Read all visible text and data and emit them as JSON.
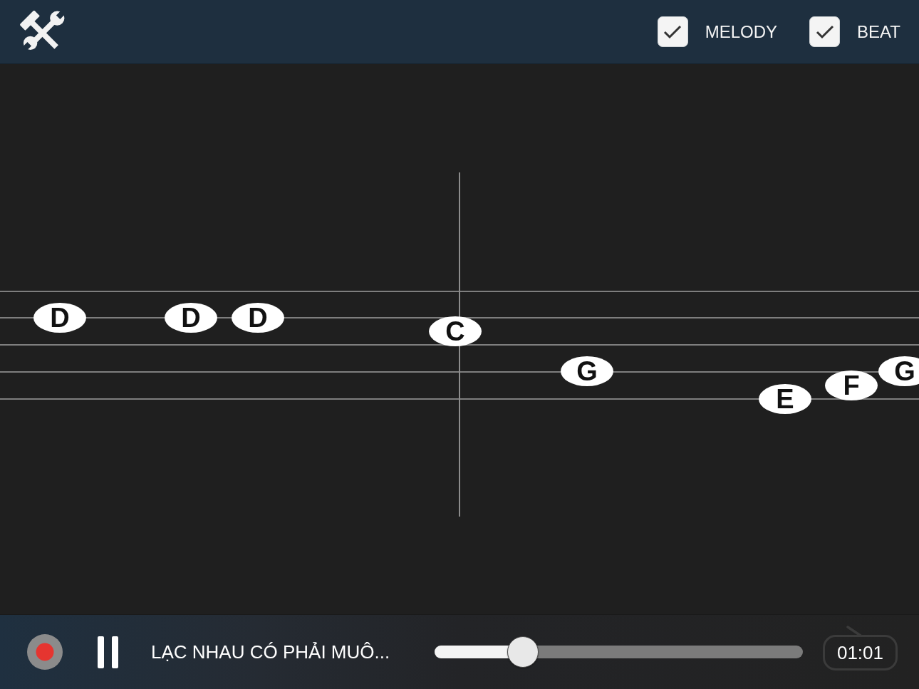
{
  "toolbar": {
    "options": [
      {
        "label": "MELODY",
        "checked": true
      },
      {
        "label": "BEAT",
        "checked": true
      }
    ]
  },
  "staff": {
    "notes": [
      {
        "label": "D"
      },
      {
        "label": "D"
      },
      {
        "label": "D"
      },
      {
        "label": "C"
      },
      {
        "label": "G"
      },
      {
        "label": "E"
      },
      {
        "label": "F"
      },
      {
        "label": "G"
      }
    ]
  },
  "player": {
    "playing": true,
    "title": "LẠC NHAU CÓ PHẢI MUÔ...",
    "progress": {
      "level": 0.24
    },
    "time": "01:01"
  }
}
